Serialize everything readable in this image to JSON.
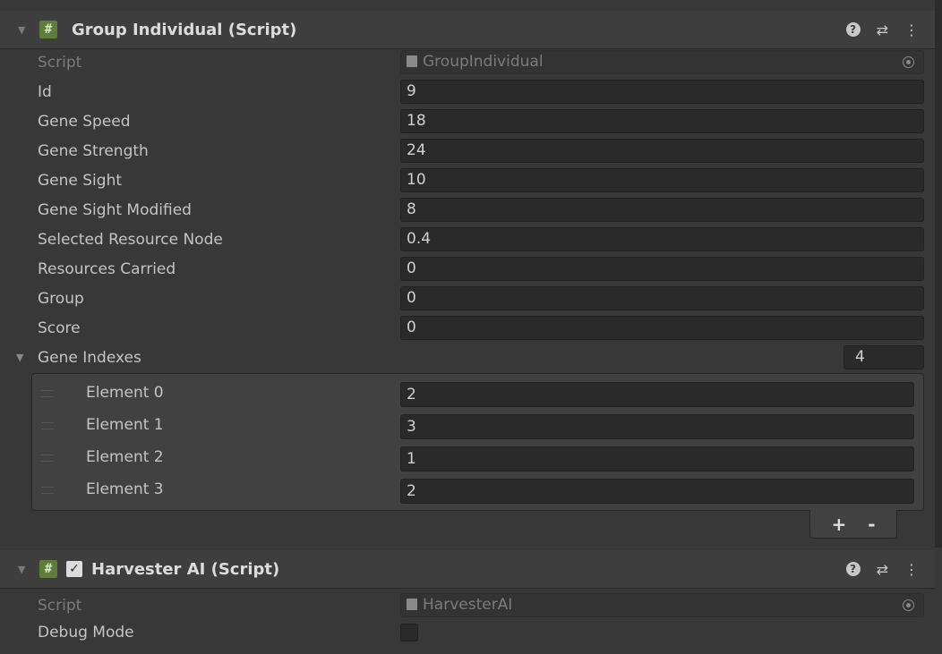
{
  "component1": {
    "title": "Group Individual (Script)",
    "script_label": "Script",
    "script_value": "GroupIndividual",
    "fields": [
      {
        "label": "Id",
        "value": "9"
      },
      {
        "label": "Gene Speed",
        "value": "18"
      },
      {
        "label": "Gene Strength",
        "value": "24"
      },
      {
        "label": "Gene Sight",
        "value": "10"
      },
      {
        "label": "Gene Sight Modified",
        "value": "8"
      },
      {
        "label": "Selected Resource Node",
        "value": "0.4"
      },
      {
        "label": "Resources Carried",
        "value": "0"
      },
      {
        "label": "Group",
        "value": "0"
      },
      {
        "label": "Score",
        "value": "0"
      }
    ],
    "list": {
      "label": "Gene Indexes",
      "size": "4",
      "elements": [
        {
          "label": "Element 0",
          "value": "2"
        },
        {
          "label": "Element 1",
          "value": "3"
        },
        {
          "label": "Element 2",
          "value": "1"
        },
        {
          "label": "Element 3",
          "value": "2"
        }
      ],
      "add_label": "+",
      "remove_label": "-"
    }
  },
  "component2": {
    "title": "Harvester AI (Script)",
    "enabled": true,
    "script_label": "Script",
    "script_value": "HarvesterAI",
    "debug_label": "Debug Mode",
    "debug_value": false
  },
  "icons": {
    "fold": "fold-arrow-icon",
    "script": "csharp-script-icon",
    "help": "help-icon",
    "presets": "presets-icon",
    "menu": "kebab-menu-icon"
  }
}
